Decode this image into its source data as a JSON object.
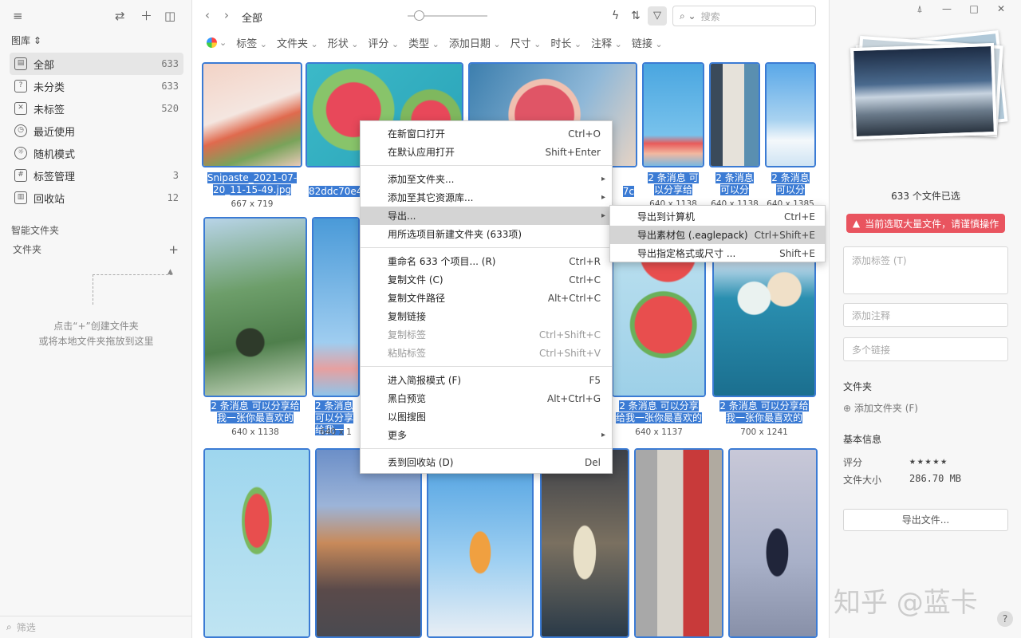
{
  "sidebar": {
    "library_label": "图库 ⇕",
    "library_items": [
      {
        "label": "全部",
        "count": "633",
        "icon": "archive-icon"
      },
      {
        "label": "未分类",
        "count": "633",
        "icon": "uncategorized-icon"
      },
      {
        "label": "未标签",
        "count": "520",
        "icon": "untagged-icon"
      },
      {
        "label": "最近使用",
        "count": "",
        "icon": "clock-icon"
      },
      {
        "label": "随机模式",
        "count": "",
        "icon": "bulb-icon"
      },
      {
        "label": "标签管理",
        "count": "3",
        "icon": "tag-manage-icon"
      },
      {
        "label": "回收站",
        "count": "12",
        "icon": "trash-icon"
      }
    ],
    "smart_folders": "智能文件夹",
    "folders": "文件夹",
    "folders_add": "+",
    "hint_line1": "点击“+”创建文件夹",
    "hint_line2": "或将本地文件夹拖放到这里",
    "filter_placeholder": "筛选"
  },
  "toolbar": {
    "breadcrumb": "全部",
    "search_placeholder": "搜索"
  },
  "filters": [
    "标签",
    "文件夹",
    "形状",
    "评分",
    "类型",
    "添加日期",
    "尺寸",
    "时长",
    "注释",
    "链接"
  ],
  "grid": {
    "tiles": [
      {
        "name": "Snipaste_2021-07-20_11-15-49.jpg",
        "dims": "667 x 719"
      },
      {
        "name": "82ddc70e4",
        "dims": ""
      },
      {
        "name": "7c",
        "dims": ""
      },
      {
        "name": "2 条消息 可以分享给",
        "dims": "640 x 1138"
      },
      {
        "name": "2 条消息 可以分",
        "dims": "640 x 1138"
      },
      {
        "name": "2 条消息 可以分",
        "dims": "640 x 1385"
      },
      {
        "name": "2 条消息 可以分享给我一张你最喜欢的",
        "dims": "640 x 1138"
      },
      {
        "name": "2 条消息 可以分享给我一",
        "dims": "640 x 1"
      },
      {
        "name": "2 条消息 可以分享给我一张你最喜欢的",
        "dims": "640 x 1137"
      },
      {
        "name": "2 条消息 可以分享给我一张你最喜欢的",
        "dims": "700 x 1241"
      }
    ]
  },
  "context_menu": {
    "items": [
      {
        "label": "在新窗口打开",
        "shortcut": "Ctrl+O"
      },
      {
        "label": "在默认应用打开",
        "shortcut": "Shift+Enter"
      },
      {
        "label": "添加至文件夹...",
        "shortcut": ""
      },
      {
        "label": "添加至其它资源库...",
        "shortcut": ""
      },
      {
        "label": "导出...",
        "shortcut": ""
      },
      {
        "label": "用所选项目新建文件夹 (633项)",
        "shortcut": ""
      },
      {
        "label": "重命名 633 个项目... (R)",
        "shortcut": "Ctrl+R"
      },
      {
        "label": "复制文件 (C)",
        "shortcut": "Ctrl+C"
      },
      {
        "label": "复制文件路径",
        "shortcut": "Alt+Ctrl+C"
      },
      {
        "label": "复制链接",
        "shortcut": ""
      },
      {
        "label": "复制标签",
        "shortcut": "Ctrl+Shift+C"
      },
      {
        "label": "粘贴标签",
        "shortcut": "Ctrl+Shift+V"
      },
      {
        "label": "进入简报模式 (F)",
        "shortcut": "F5"
      },
      {
        "label": "黑白预览",
        "shortcut": "Alt+Ctrl+G"
      },
      {
        "label": "以图搜图",
        "shortcut": ""
      },
      {
        "label": "更多",
        "shortcut": ""
      },
      {
        "label": "丢到回收站 (D)",
        "shortcut": "Del"
      }
    ],
    "export_submenu": [
      {
        "label": "导出到计算机",
        "shortcut": "Ctrl+E"
      },
      {
        "label": "导出素材包 (.eaglepack)",
        "shortcut": "Ctrl+Shift+E"
      },
      {
        "label": "导出指定格式或尺寸 ...",
        "shortcut": "Shift+E"
      }
    ]
  },
  "inspector": {
    "selected_count": "633 个文件已选",
    "warning": "当前选取大量文件，请谨慎操作",
    "add_tags": "添加标签 (T)",
    "add_notes": "添加注释",
    "add_links": "多个链接",
    "folder_title": "文件夹",
    "add_folder": "添加文件夹 (F)",
    "basic_info": "基本信息",
    "rating_label": "评分",
    "stars": "★★★★★",
    "size_label": "文件大小",
    "size_value": "286.70 MB",
    "export_button": "导出文件...",
    "help": "?"
  },
  "watermark": "知乎 @蓝卡",
  "colors": {
    "accent": "#3b7bd4",
    "warning": "#e9545f"
  }
}
